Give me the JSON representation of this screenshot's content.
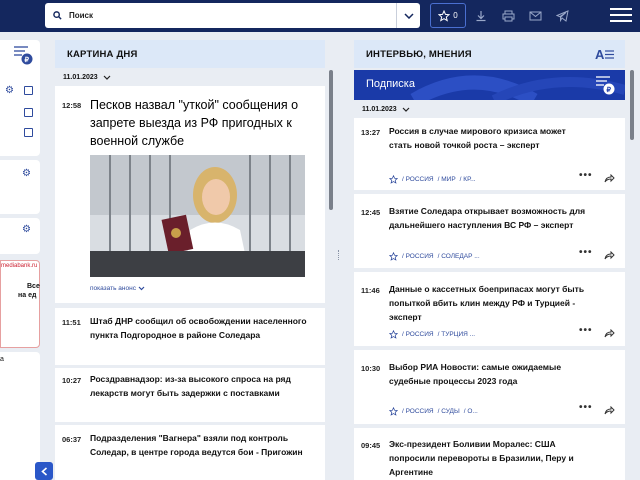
{
  "search": {
    "placeholder": "Поиск"
  },
  "toolbar": {
    "favorites_count": "0"
  },
  "left": {
    "partner_text": "mediabank.ru",
    "promo_line1": "Все",
    "promo_line2": "на ед",
    "fragment": "а"
  },
  "day": {
    "header": "КАРТИНА ДНЯ",
    "date": "11.01.2023",
    "expand_label": "показать анонс",
    "items": [
      {
        "time": "12:58",
        "title": "Песков назвал \"уткой\" сообщения о запрете выезда из РФ пригодных к военной службе"
      },
      {
        "time": "11:51",
        "title": "Штаб ДНР сообщил об освобождении населенного пункта Подгородное в районе Соледара"
      },
      {
        "time": "10:27",
        "title": "Росздравнадзор: из-за высокого спроса на ряд лекарств могут быть задержки с поставками"
      },
      {
        "time": "06:37",
        "title": "Подразделения \"Вагнера\" взяли под контроль Соледар, в центре города ведутся бои - Пригожин"
      }
    ]
  },
  "opinions": {
    "header": "ИНТЕРВЬЮ, МНЕНИЯ",
    "subscribe": "Подписка",
    "date": "11.01.2023",
    "items": [
      {
        "time": "13:27",
        "title": "Россия в случае мирового кризиса может стать новой точкой роста – эксперт",
        "tags": [
          "/ РОССИЯ",
          "/ МИР",
          "/ КР..."
        ]
      },
      {
        "time": "12:45",
        "title": "Взятие Соледара открывает возможность для дальнейшего наступления ВС РФ – эксперт",
        "tags": [
          "/ РОССИЯ",
          "/ СОЛЕДАР ..."
        ]
      },
      {
        "time": "11:46",
        "title": "Данные о кассетных боеприпасах могут быть попыткой вбить клин между РФ и Турцией - эксперт",
        "tags": [
          "/ РОССИЯ",
          "/ ТУРЦИЯ ..."
        ]
      },
      {
        "time": "10:30",
        "title": "Выбор РИА Новости: самые ожидаемые судебные процессы 2023 года",
        "tags": [
          "/ РОССИЯ",
          "/ СУДЫ",
          "/ О..."
        ]
      },
      {
        "time": "09:45",
        "title": "Экс-президент Боливии Моралес: США попросили перевороты в Бразилии, Перу и Аргентине",
        "tags": []
      }
    ]
  },
  "colors": {
    "topbar": "#14275e",
    "accent": "#2a57c8",
    "column_header": "#dce8f8"
  }
}
